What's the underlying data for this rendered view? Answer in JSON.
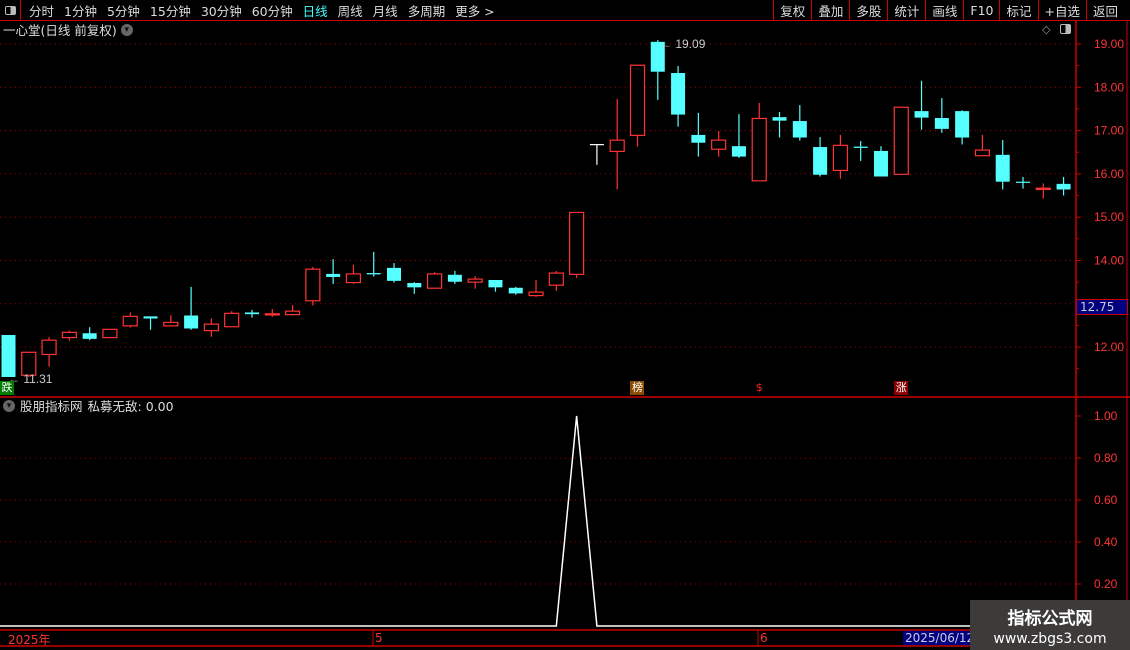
{
  "toolbar": {
    "periods": [
      "分时",
      "1分钟",
      "5分钟",
      "15分钟",
      "30分钟",
      "60分钟",
      "日线",
      "周线",
      "月线",
      "多周期",
      "更多 >"
    ],
    "active_period": "日线",
    "buttons": [
      "复权",
      "叠加",
      "多股",
      "统计",
      "画线",
      "F10",
      "标记",
      "+自选",
      "返回"
    ]
  },
  "main": {
    "title": "一心堂(日线 前复权)",
    "high_label": "19.09",
    "low_label": "11.31",
    "current_price": "12.75",
    "markers": [
      {
        "text": "跌",
        "color": "#007a00",
        "index": 0
      },
      {
        "text": "榜",
        "color": "#8a4a00",
        "index": 31
      },
      {
        "text": "$",
        "color": "transparent",
        "index": 37
      },
      {
        "text": "涨",
        "color": "#8a0000",
        "index": 44
      }
    ]
  },
  "indicator": {
    "name": "股朋指标网",
    "series": "私募无敌",
    "value": "0.00"
  },
  "dates": {
    "labels": [
      "2025年",
      "5",
      "6"
    ],
    "highlight": "2025/06/12/"
  },
  "watermark": {
    "line1": "指标公式网",
    "line2": "www.zbgs3.com"
  },
  "colors": {
    "up": "#ff3333",
    "down": "#55ffff",
    "grid": "#aa0000",
    "axis": "#ff3333",
    "flat": "#ffffff"
  },
  "chart_data": [
    {
      "type": "candlestick",
      "title": "一心堂(日线 前复权)",
      "ylim": [
        11.0,
        19.3
      ],
      "yticks": [
        12,
        13,
        14,
        15,
        16,
        17,
        18,
        19
      ],
      "ytick_labels": [
        "12.00",
        "13.00",
        "14.00",
        "15.00",
        "16.00",
        "17.00",
        "18.00",
        "19.00"
      ],
      "grid": true,
      "ohlc": [
        [
          12.28,
          12.28,
          11.31,
          11.31
        ],
        [
          11.35,
          11.88,
          11.31,
          11.88
        ],
        [
          11.83,
          12.23,
          11.55,
          12.16
        ],
        [
          12.22,
          12.38,
          12.15,
          12.34
        ],
        [
          12.32,
          12.46,
          12.16,
          12.19
        ],
        [
          12.22,
          12.41,
          12.22,
          12.41
        ],
        [
          12.49,
          12.8,
          12.45,
          12.71
        ],
        [
          12.71,
          12.71,
          12.4,
          12.66
        ],
        [
          12.49,
          12.74,
          12.49,
          12.57
        ],
        [
          12.73,
          13.39,
          12.4,
          12.43
        ],
        [
          12.38,
          12.66,
          12.24,
          12.53
        ],
        [
          12.47,
          12.83,
          12.47,
          12.78
        ],
        [
          12.8,
          12.86,
          12.68,
          12.76
        ],
        [
          12.75,
          12.88,
          12.7,
          12.77
        ],
        [
          12.75,
          12.97,
          12.73,
          12.83
        ],
        [
          13.07,
          13.85,
          12.96,
          13.8
        ],
        [
          13.69,
          14.03,
          13.46,
          13.62
        ],
        [
          13.49,
          13.9,
          13.46,
          13.69
        ],
        [
          13.71,
          14.2,
          13.63,
          13.68
        ],
        [
          13.83,
          13.94,
          13.49,
          13.53
        ],
        [
          13.48,
          13.5,
          13.23,
          13.38
        ],
        [
          13.36,
          13.73,
          13.36,
          13.69
        ],
        [
          13.67,
          13.76,
          13.46,
          13.51
        ],
        [
          13.5,
          13.64,
          13.35,
          13.57
        ],
        [
          13.55,
          13.55,
          13.28,
          13.38
        ],
        [
          13.37,
          13.39,
          13.21,
          13.24
        ],
        [
          13.19,
          13.55,
          13.16,
          13.27
        ],
        [
          13.43,
          13.76,
          13.3,
          13.71
        ],
        [
          13.68,
          15.11,
          13.6,
          15.11
        ],
        [
          16.69,
          16.69,
          16.21,
          16.69
        ],
        [
          16.52,
          17.73,
          15.64,
          16.78
        ],
        [
          16.89,
          18.51,
          16.63,
          18.51
        ],
        [
          19.05,
          19.09,
          17.71,
          18.36
        ],
        [
          18.33,
          18.49,
          17.09,
          17.37
        ],
        [
          16.9,
          17.41,
          16.4,
          16.72
        ],
        [
          16.57,
          16.99,
          16.4,
          16.78
        ],
        [
          16.64,
          17.38,
          16.37,
          16.4
        ],
        [
          15.84,
          17.64,
          15.84,
          17.28
        ],
        [
          17.31,
          17.43,
          16.84,
          17.23
        ],
        [
          17.22,
          17.59,
          16.77,
          16.84
        ],
        [
          16.62,
          16.85,
          15.94,
          15.98
        ],
        [
          16.08,
          16.9,
          15.89,
          16.66
        ],
        [
          16.63,
          16.76,
          16.3,
          16.6
        ],
        [
          16.53,
          16.64,
          15.94,
          15.94
        ],
        [
          15.99,
          17.54,
          15.99,
          17.54
        ],
        [
          17.45,
          18.15,
          17.02,
          17.3
        ],
        [
          17.29,
          17.75,
          16.95,
          17.04
        ],
        [
          17.45,
          17.47,
          16.68,
          16.84
        ],
        [
          16.42,
          16.9,
          16.42,
          16.55
        ],
        [
          16.44,
          16.78,
          15.64,
          15.82
        ],
        [
          15.82,
          15.93,
          15.66,
          15.8
        ],
        [
          15.66,
          15.78,
          15.43,
          15.67
        ],
        [
          15.77,
          15.93,
          15.5,
          15.64
        ]
      ]
    },
    {
      "type": "line",
      "title": "私募无敌",
      "ylim": [
        0,
        1.05
      ],
      "yticks": [
        0.2,
        0.4,
        0.6,
        0.8,
        1.0
      ],
      "ytick_labels": [
        "0.20",
        "0.40",
        "0.60",
        "0.80",
        "1.00"
      ],
      "grid": true,
      "values": [
        0,
        0,
        0,
        0,
        0,
        0,
        0,
        0,
        0,
        0,
        0,
        0,
        0,
        0,
        0,
        0,
        0,
        0,
        0,
        0,
        0,
        0,
        0,
        0,
        0,
        0,
        0,
        0,
        1,
        0,
        0,
        0,
        0,
        0,
        0,
        0,
        0,
        0,
        0,
        0,
        0,
        0,
        0,
        0,
        0,
        0,
        0,
        0,
        0,
        0,
        0,
        0,
        0
      ]
    }
  ]
}
